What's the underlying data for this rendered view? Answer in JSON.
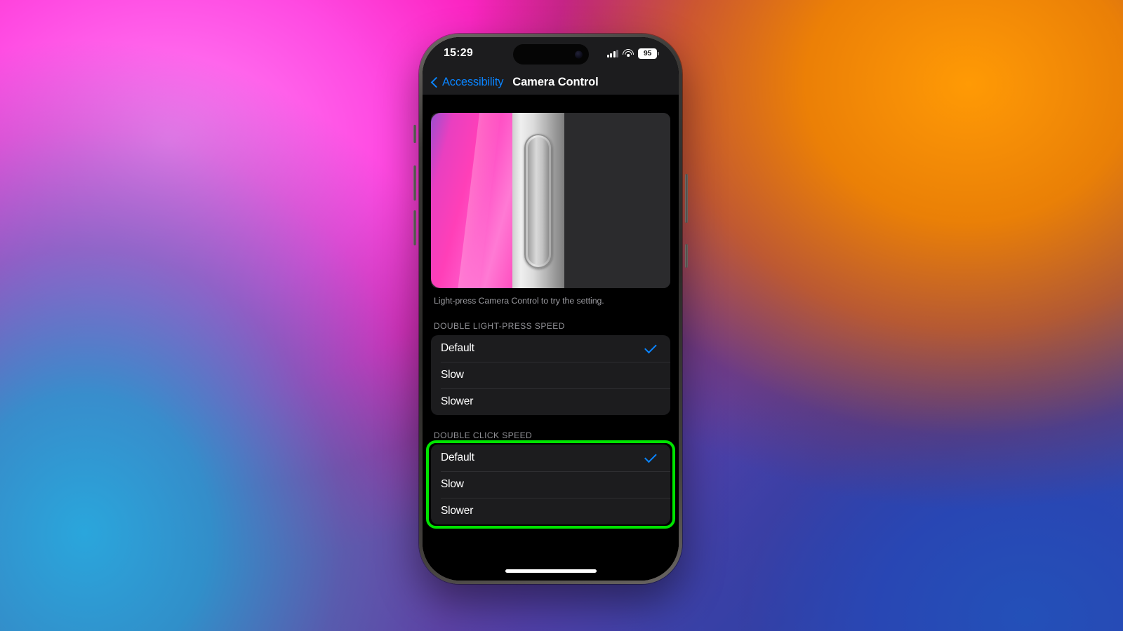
{
  "status_bar": {
    "time": "15:29",
    "cellular_icon": "signal-bars-icon",
    "wifi_icon": "wifi-icon",
    "battery_level": "95",
    "battery_icon": "battery-icon"
  },
  "nav_bar": {
    "back_icon": "chevron-left-icon",
    "back_label": "Accessibility",
    "title": "Camera Control"
  },
  "preview": {
    "name": "camera-control-illustration",
    "caption": "Light-press Camera Control to try the setting."
  },
  "sections": [
    {
      "header": "DOUBLE LIGHT-PRESS SPEED",
      "name": "double-light-press-speed",
      "highlighted": false,
      "options": [
        {
          "label": "Default",
          "selected": true
        },
        {
          "label": "Slow",
          "selected": false
        },
        {
          "label": "Slower",
          "selected": false
        }
      ]
    },
    {
      "header": "DOUBLE CLICK SPEED",
      "name": "double-click-speed",
      "highlighted": true,
      "options": [
        {
          "label": "Default",
          "selected": true
        },
        {
          "label": "Slow",
          "selected": false
        },
        {
          "label": "Slower",
          "selected": false
        }
      ]
    }
  ],
  "colors": {
    "accent_blue": "#0A84FF",
    "highlight_green": "#00E300",
    "group_background": "#1C1C1E",
    "screen_background": "#000000",
    "secondary_text": "#919196"
  },
  "home_indicator": "home-indicator"
}
